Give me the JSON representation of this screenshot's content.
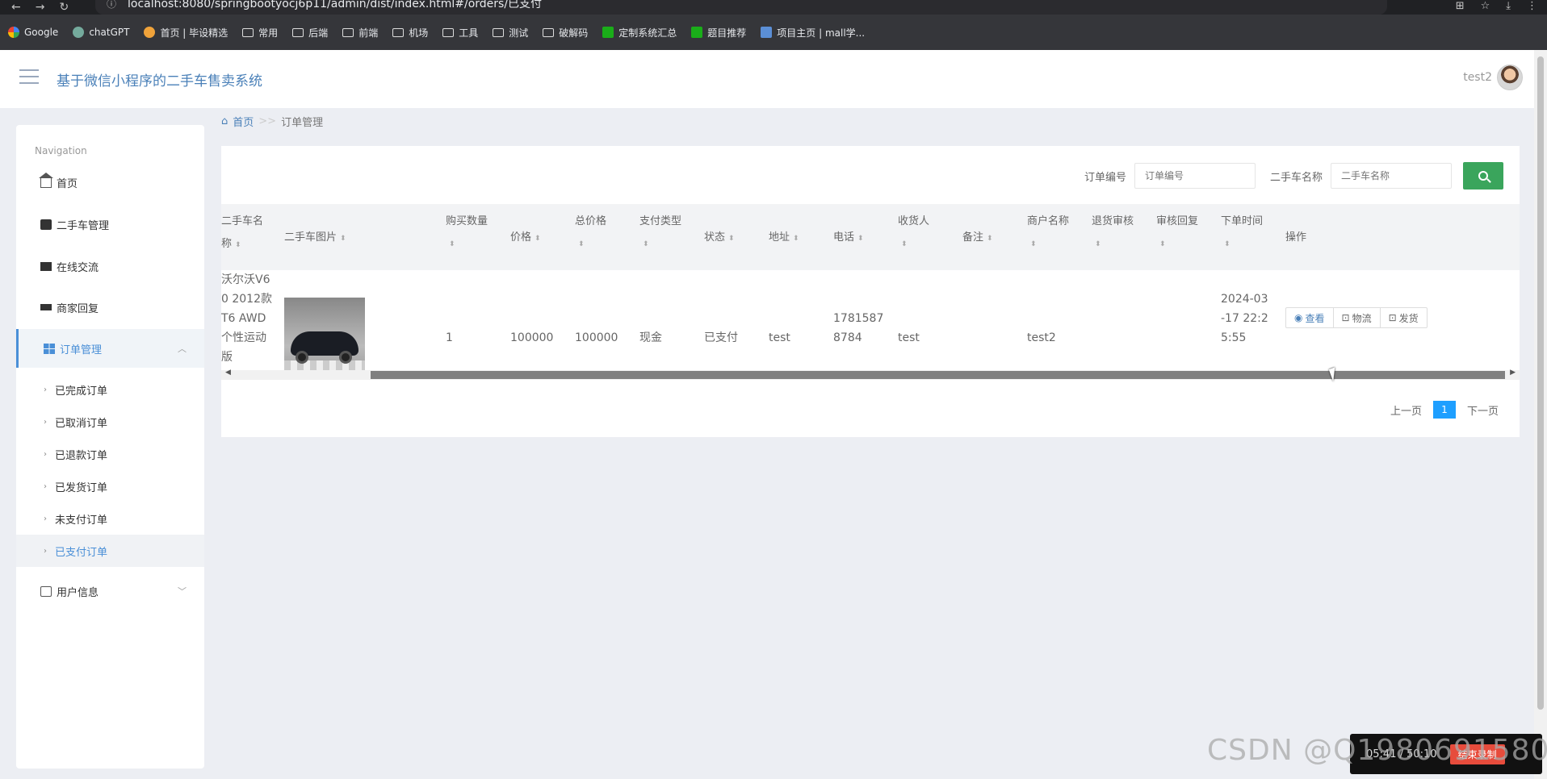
{
  "browser": {
    "url": "localhost:8080/springbootyocj6p11/admin/dist/index.html#/orders/已支付",
    "bookmarks": [
      "Google",
      "chatGPT",
      "首页 | 毕设精选",
      "常用",
      "后端",
      "前端",
      "机场",
      "工具",
      "测试",
      "破解码",
      "定制系统汇总",
      "题目推荐",
      "项目主页 | mall学..."
    ]
  },
  "header": {
    "title": "基于微信小程序的二手车售卖系统",
    "username": "test2"
  },
  "sidebar": {
    "heading": "Navigation",
    "items": [
      {
        "label": "首页",
        "icon": "home-icon"
      },
      {
        "label": "二手车管理",
        "icon": "car-icon"
      },
      {
        "label": "在线交流",
        "icon": "monitor-icon"
      },
      {
        "label": "商家回复",
        "icon": "reply-icon"
      },
      {
        "label": "订单管理",
        "icon": "grid-icon"
      },
      {
        "label": "用户信息",
        "icon": "card-icon"
      }
    ],
    "subitems": [
      "已完成订单",
      "已取消订单",
      "已退款订单",
      "已发货订单",
      "未支付订单",
      "已支付订单"
    ]
  },
  "breadcrumb": {
    "home": "首页",
    "sep": ">>",
    "current": "订单管理"
  },
  "search": {
    "order_label": "订单编号",
    "order_placeholder": "订单编号",
    "car_label": "二手车名称",
    "car_placeholder": "二手车名称"
  },
  "table": {
    "headers": [
      "二手车名称",
      "二手车图片",
      "购买数量",
      "价格",
      "总价格",
      "支付类型",
      "状态",
      "地址",
      "电话",
      "收货人",
      "备注",
      "商户名称",
      "退货审核",
      "审核回复",
      "下单时间",
      "操作"
    ],
    "header_lines": {
      "car_name_1": "二手车名",
      "car_name_2": "称",
      "qty": "购买数量",
      "total": "总价格",
      "paytype": "支付类型",
      "consignee": "收货人",
      "merchant": "商户名称",
      "refund": "退货审核",
      "reply": "审核回复",
      "time": "下单时间"
    },
    "row": {
      "car_name_lines": [
        "沃尔沃V6",
        "0 2012款",
        "T6 AWD",
        "个性运动",
        "版"
      ],
      "qty": "1",
      "price": "100000",
      "total": "100000",
      "paytype": "现金",
      "status": "已支付",
      "address": "test",
      "phone_lines": [
        "1781587",
        "8784"
      ],
      "consignee": "test",
      "remark": "",
      "merchant": "test2",
      "refund": "",
      "reply": "",
      "time_lines": [
        "2024-03",
        "-17 22:2",
        "5:55"
      ]
    },
    "actions": {
      "view": "查看",
      "logistics": "物流",
      "ship": "发货"
    }
  },
  "pager": {
    "prev": "上一页",
    "page": "1",
    "next": "下一页"
  },
  "recorder": {
    "time": "05:41 / 50:10",
    "stop": "结束录制"
  },
  "watermark": "CSDN @Q1980691580"
}
